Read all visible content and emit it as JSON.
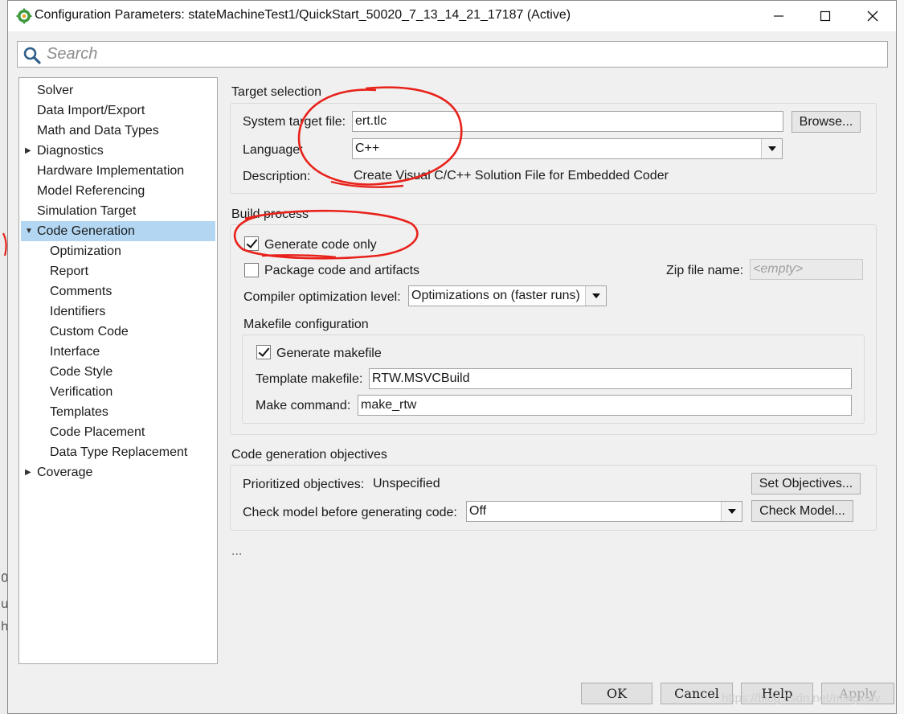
{
  "window": {
    "title": "Configuration Parameters: stateMachineTest1/QuickStart_50020_7_13_14_21_17187 (Active)"
  },
  "search": {
    "placeholder": "Search"
  },
  "tree": {
    "items": [
      {
        "label": "Solver",
        "expander": ""
      },
      {
        "label": "Data Import/Export",
        "expander": ""
      },
      {
        "label": "Math and Data Types",
        "expander": ""
      },
      {
        "label": "Diagnostics",
        "expander": "collapsed"
      },
      {
        "label": "Hardware Implementation",
        "expander": ""
      },
      {
        "label": "Model Referencing",
        "expander": ""
      },
      {
        "label": "Simulation Target",
        "expander": ""
      },
      {
        "label": "Code Generation",
        "expander": "expanded",
        "selected": true
      },
      {
        "label": "Optimization",
        "child": true
      },
      {
        "label": "Report",
        "child": true
      },
      {
        "label": "Comments",
        "child": true
      },
      {
        "label": "Identifiers",
        "child": true
      },
      {
        "label": "Custom Code",
        "child": true
      },
      {
        "label": "Interface",
        "child": true
      },
      {
        "label": "Code Style",
        "child": true
      },
      {
        "label": "Verification",
        "child": true
      },
      {
        "label": "Templates",
        "child": true
      },
      {
        "label": "Code Placement",
        "child": true
      },
      {
        "label": "Data Type Replacement",
        "child": true
      },
      {
        "label": "Coverage",
        "expander": "collapsed"
      }
    ]
  },
  "target_selection": {
    "heading": "Target selection",
    "system_target_file_label": "System target file:",
    "system_target_file_value": "ert.tlc",
    "browse_label": "Browse...",
    "language_label": "Language:",
    "language_value": "C++",
    "description_label": "Description:",
    "description_value": "Create Visual C/C++ Solution File for Embedded Coder"
  },
  "build_process": {
    "heading": "Build process",
    "generate_code_only_label": "Generate code only",
    "generate_code_only_checked": true,
    "package_label": "Package code and artifacts",
    "package_checked": false,
    "zip_label": "Zip file name:",
    "zip_placeholder": "<empty>",
    "compiler_opt_label": "Compiler optimization level:",
    "compiler_opt_value": "Optimizations on (faster runs)",
    "makefile_heading": "Makefile configuration",
    "generate_makefile_label": "Generate makefile",
    "generate_makefile_checked": true,
    "template_makefile_label": "Template makefile:",
    "template_makefile_value": "RTW.MSVCBuild",
    "make_command_label": "Make command:",
    "make_command_value": "make_rtw"
  },
  "objectives": {
    "heading": "Code generation objectives",
    "prioritized_label": "Prioritized objectives:",
    "prioritized_value": "Unspecified",
    "set_objectives_label": "Set Objectives...",
    "check_model_label": "Check model before generating code:",
    "check_model_value": "Off",
    "check_model_button": "Check Model..."
  },
  "more_indicator": "...",
  "buttons": {
    "ok": "OK",
    "cancel": "Cancel",
    "help": "Help",
    "apply": "Apply"
  },
  "watermark": "https://blog.csdn.net/mingxeiv",
  "colors": {
    "selection": "#b3d7f3",
    "annotation": "#e8221b",
    "dialog_bg": "#f0f0f0"
  }
}
